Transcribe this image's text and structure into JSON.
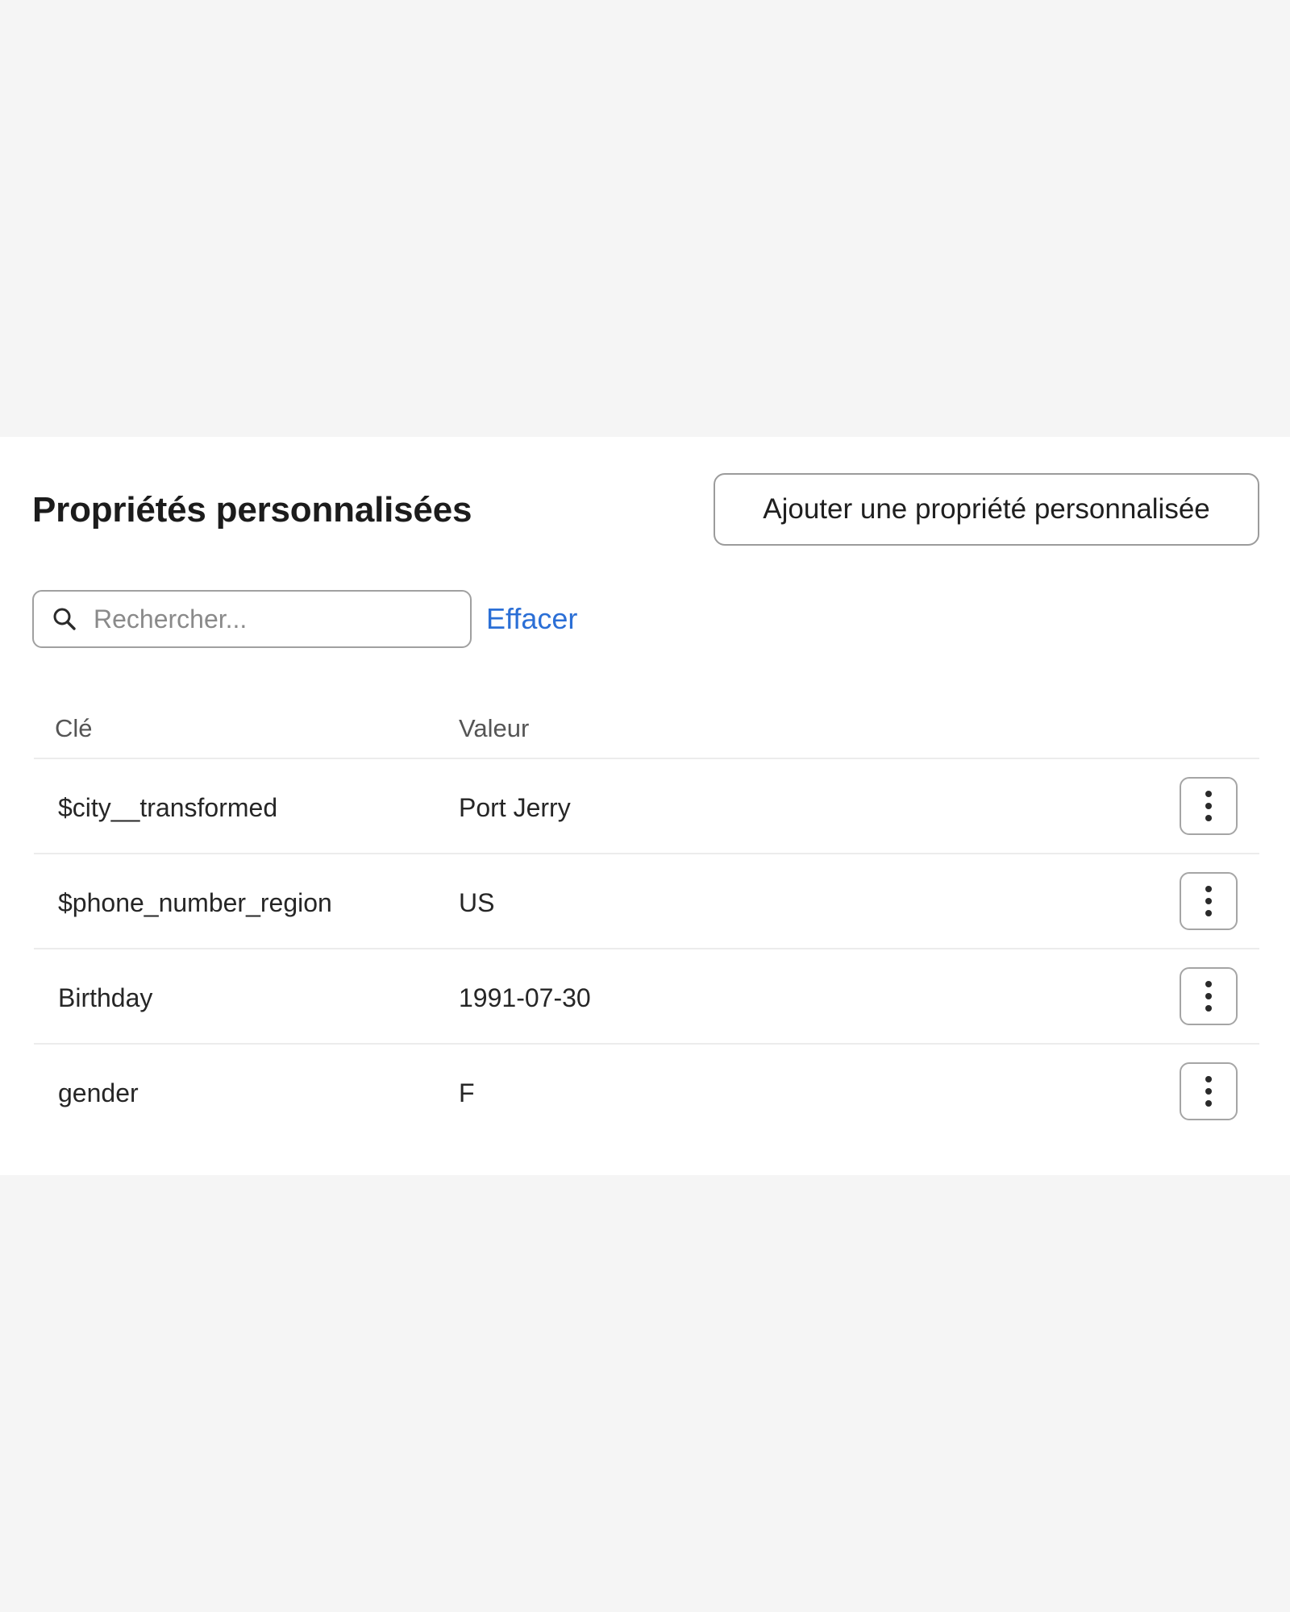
{
  "panel": {
    "title": "Propriétés personnalisées",
    "add_button_label": "Ajouter une propriété personnalisée"
  },
  "search": {
    "placeholder": "Rechercher...",
    "value": "",
    "icon": "search-icon",
    "clear_label": "Effacer"
  },
  "table": {
    "columns": [
      "Clé",
      "Valeur"
    ],
    "rows": [
      {
        "key": "$city__transformed",
        "value": "Port Jerry"
      },
      {
        "key": "$phone_number_region",
        "value": "US"
      },
      {
        "key": "Birthday",
        "value": "1991-07-30"
      },
      {
        "key": "gender",
        "value": "F"
      }
    ],
    "row_action_icon": "more-vertical-icon"
  },
  "colors": {
    "page_background": "#f5f5f5",
    "panel_background": "#ffffff",
    "link": "#2b6fd6",
    "border": "#a0a0a0"
  }
}
